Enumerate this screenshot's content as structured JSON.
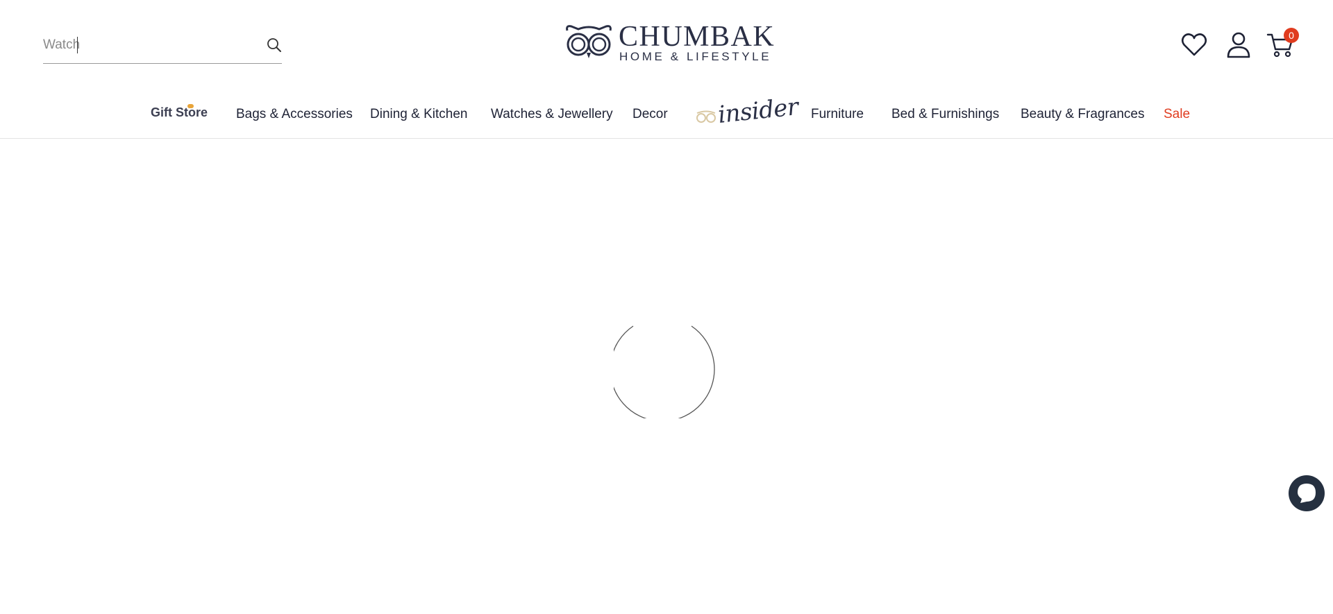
{
  "search": {
    "value": "Watch",
    "icon": "search-icon"
  },
  "logo": {
    "brand": "CHUMBAK",
    "tagline": "HOME & LIFESTYLE",
    "icon": "owl-logo-icon"
  },
  "header_actions": {
    "wishlist_icon": "heart-icon",
    "account_icon": "user-icon",
    "cart_icon": "cart-icon",
    "cart_count": "0"
  },
  "nav": {
    "gift_store": "Gift Store",
    "items": [
      "Bags & Accessories",
      "Dining & Kitchen",
      "Watches & Jewellery",
      "Decor",
      "Furniture",
      "Bed & Furnishings",
      "Beauty & Fragrances",
      "Sale"
    ],
    "insider": "insider"
  },
  "colors": {
    "text": "#1e2235",
    "accent": "#e03c1f",
    "brand": "#2a2f45"
  },
  "loading": {
    "icon": "loading-spinner-icon"
  },
  "chat": {
    "icon": "chat-bubble-icon"
  }
}
